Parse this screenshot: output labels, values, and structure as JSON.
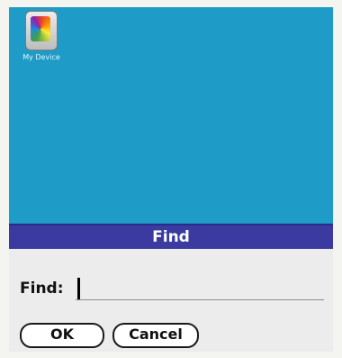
{
  "desktop": {
    "icon_label": "My Device",
    "icon_name": "device-icon",
    "background_color": "#1e9bc6"
  },
  "dialog": {
    "title": "Find",
    "find_label": "Find:",
    "find_value": "",
    "ok_label": "OK",
    "cancel_label": "Cancel",
    "titlebar_color": "#3a3aa0"
  }
}
